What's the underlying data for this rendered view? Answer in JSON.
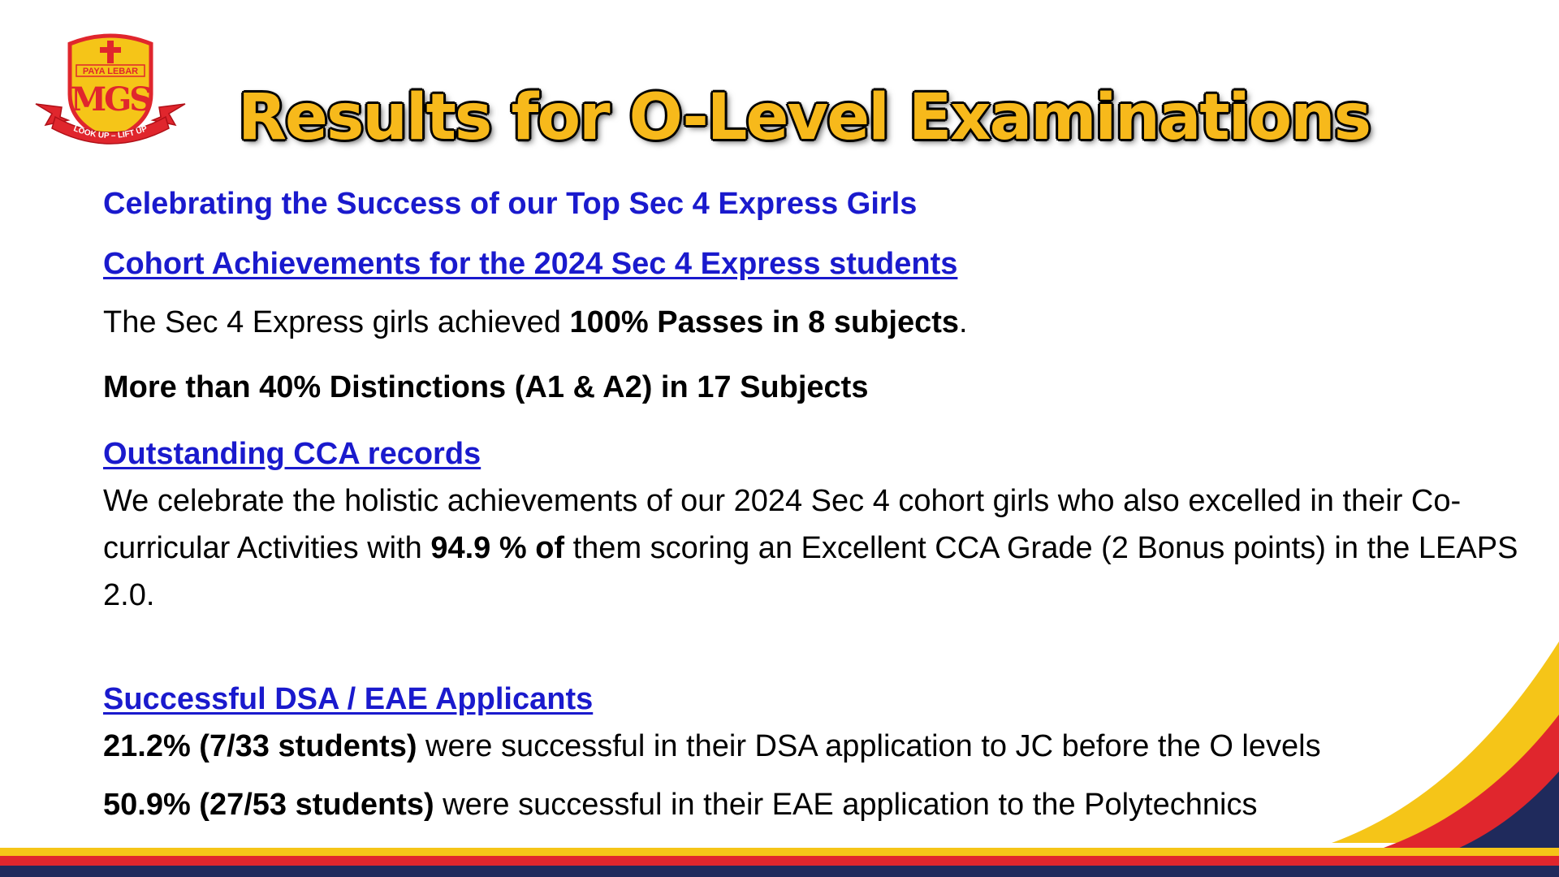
{
  "logo": {
    "school": "PAYA LEBAR",
    "initials": "MGS",
    "motto": "LOOK UP – LIFT UP"
  },
  "title": "Results for O-Level Examinations",
  "heading_celebrate": "Celebrating the Success of our Top Sec 4 Express Girls",
  "cohort": {
    "heading": "Cohort Achievements for the 2024 Sec 4 Express students",
    "passes_prefix": "The Sec 4 Express girls achieved ",
    "passes_bold": "100% Passes in 8 subjects",
    "passes_suffix": ".",
    "distinctions": "More than 40% Distinctions (A1 & A2) in 17 Subjects"
  },
  "cca": {
    "heading": "Outstanding CCA records",
    "text_prefix": "We celebrate the holistic achievements of our 2024 Sec 4 cohort girls who also excelled in their Co-curricular Activities with ",
    "text_bold": "94.9 % of",
    "text_suffix": " them scoring an Excellent CCA Grade (2 Bonus points) in the LEAPS 2.0."
  },
  "dsa": {
    "heading": "Successful DSA / EAE Applicants",
    "line1_bold": "21.2% (7/33 students)",
    "line1_text": " were successful in their DSA application to JC before the O levels",
    "line2_bold": "50.9% (27/53 students)",
    "line2_text": " were successful in their EAE application to the Polytechnics"
  },
  "colors": {
    "title": "#f7b91b",
    "heading_blue": "#1a1acd",
    "stripe_red": "#e0262d",
    "stripe_yellow": "#f5c518",
    "stripe_navy": "#1f2a5c"
  }
}
